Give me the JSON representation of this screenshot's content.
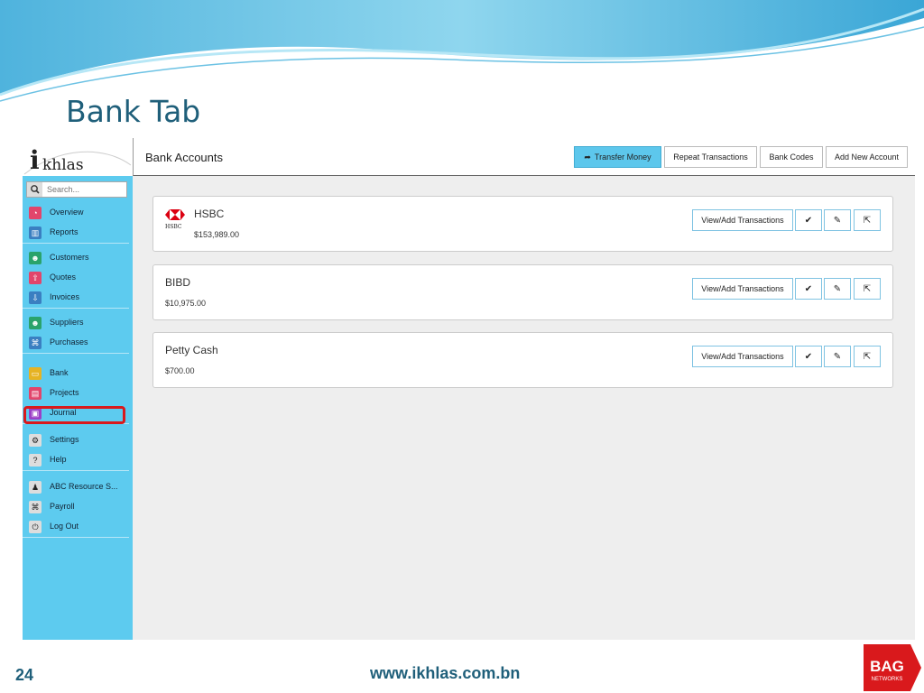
{
  "slide": {
    "title": "Bank Tab",
    "page_number": "24",
    "url": "www.ikhlas.com.bn",
    "brand_logo_text": "BAG",
    "brand_logo_subtext": "NETWORKS"
  },
  "app": {
    "logo_i": "i",
    "logo_rest": "khlas",
    "search_placeholder": "Search...",
    "nav_groups": [
      [
        {
          "label": "Overview",
          "icon": "gauge-icon",
          "color": "#e2456b"
        },
        {
          "label": "Reports",
          "icon": "chart-icon",
          "color": "#3a7fc1"
        }
      ],
      [
        {
          "label": "Customers",
          "icon": "users-icon",
          "color": "#2aa36b"
        },
        {
          "label": "Quotes",
          "icon": "inbox-upload-icon",
          "color": "#e2456b"
        },
        {
          "label": "Invoices",
          "icon": "inbox-download-icon",
          "color": "#3a7fc1"
        }
      ],
      [
        {
          "label": "Suppliers",
          "icon": "users-icon",
          "color": "#2aa36b"
        },
        {
          "label": "Purchases",
          "icon": "tag-icon",
          "color": "#3a7fc1"
        }
      ],
      [
        {
          "label": "Bank",
          "icon": "card-icon",
          "color": "#e6b323"
        },
        {
          "label": "Projects",
          "icon": "briefcase-icon",
          "color": "#e2456b"
        },
        {
          "label": "Journal",
          "icon": "book-icon",
          "color": "#9b3fc7"
        }
      ],
      [
        {
          "label": "Settings",
          "icon": "gear-icon",
          "color": "#dddddd"
        },
        {
          "label": "Help",
          "icon": "question-icon",
          "color": "#dddddd"
        }
      ],
      [
        {
          "label": "ABC Resource S...",
          "icon": "user-icon",
          "color": "#dddddd"
        },
        {
          "label": "Payroll",
          "icon": "tag-icon",
          "color": "#dddddd"
        },
        {
          "label": "Log Out",
          "icon": "power-icon",
          "color": "#dddddd"
        }
      ]
    ],
    "header": {
      "title": "Bank Accounts",
      "transfer_money": "Transfer Money",
      "repeat_transactions": "Repeat Transactions",
      "bank_codes": "Bank Codes",
      "add_new_account": "Add New Account"
    },
    "accounts": [
      {
        "name": "HSBC",
        "balance": "$153,989.00",
        "logo_text": "HSBC",
        "view_label": "View/Add Transactions"
      },
      {
        "name": "BIBD",
        "balance": "$10,975.00",
        "view_label": "View/Add Transactions"
      },
      {
        "name": "Petty Cash",
        "balance": "$700.00",
        "view_label": "View/Add Transactions"
      }
    ],
    "icon_glyphs": {
      "check": "✔",
      "edit": "✎",
      "share": "⇱"
    }
  }
}
